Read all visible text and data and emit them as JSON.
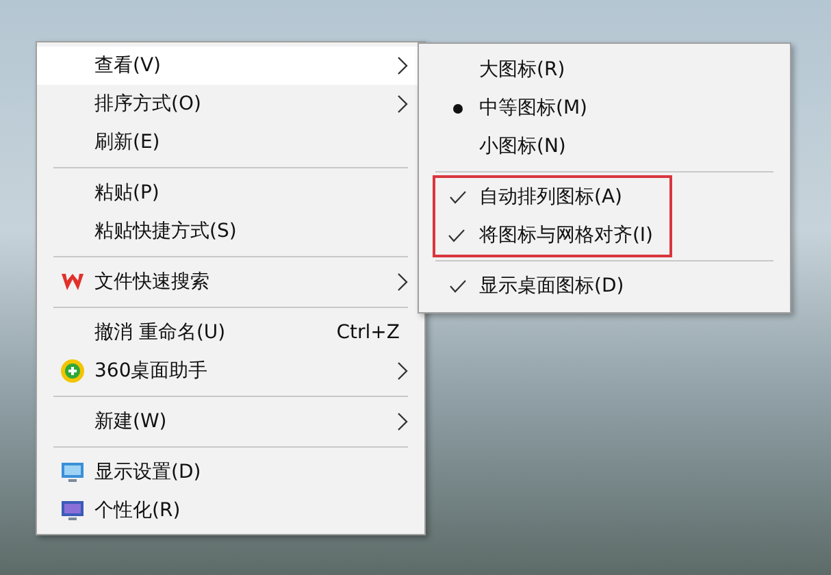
{
  "context_menu": {
    "sections": [
      {
        "items": [
          {
            "label": "查看(V)",
            "has_submenu": true,
            "selected": true
          },
          {
            "label": "排序方式(O)",
            "has_submenu": true,
            "selected": false
          },
          {
            "label": "刷新(E)",
            "has_submenu": false,
            "selected": false
          }
        ]
      },
      {
        "items": [
          {
            "label": "粘贴(P)",
            "has_submenu": false,
            "selected": false
          },
          {
            "label": "粘贴快捷方式(S)",
            "has_submenu": false,
            "selected": false
          }
        ]
      },
      {
        "items": [
          {
            "label": "文件快速搜索",
            "has_submenu": true,
            "selected": false
          }
        ]
      },
      {
        "items": [
          {
            "label": "撤消 重命名(U)",
            "shortcut": "Ctrl+Z",
            "has_submenu": false,
            "selected": false
          },
          {
            "label": "360桌面助手",
            "has_submenu": true,
            "selected": false
          }
        ]
      },
      {
        "items": [
          {
            "label": "新建(W)",
            "has_submenu": true,
            "selected": false
          }
        ]
      },
      {
        "items": [
          {
            "label": "显示设置(D)",
            "has_submenu": false,
            "selected": false
          },
          {
            "label": "个性化(R)",
            "has_submenu": false,
            "selected": false
          }
        ]
      }
    ]
  },
  "submenu": {
    "sections": [
      {
        "annotated": false,
        "items": [
          {
            "label": "大图标(R)",
            "kind": "radio",
            "selected": false
          },
          {
            "label": "中等图标(M)",
            "kind": "radio",
            "selected": true
          },
          {
            "label": "小图标(N)",
            "kind": "radio",
            "selected": false
          }
        ]
      },
      {
        "annotated": true,
        "items": [
          {
            "label": "自动排列图标(A)",
            "kind": "check",
            "checked": true
          },
          {
            "label": "将图标与网格对齐(I)",
            "kind": "check",
            "checked": true
          }
        ]
      },
      {
        "annotated": false,
        "items": [
          {
            "label": "显示桌面图标(D)",
            "kind": "check",
            "checked": true
          }
        ]
      }
    ]
  }
}
